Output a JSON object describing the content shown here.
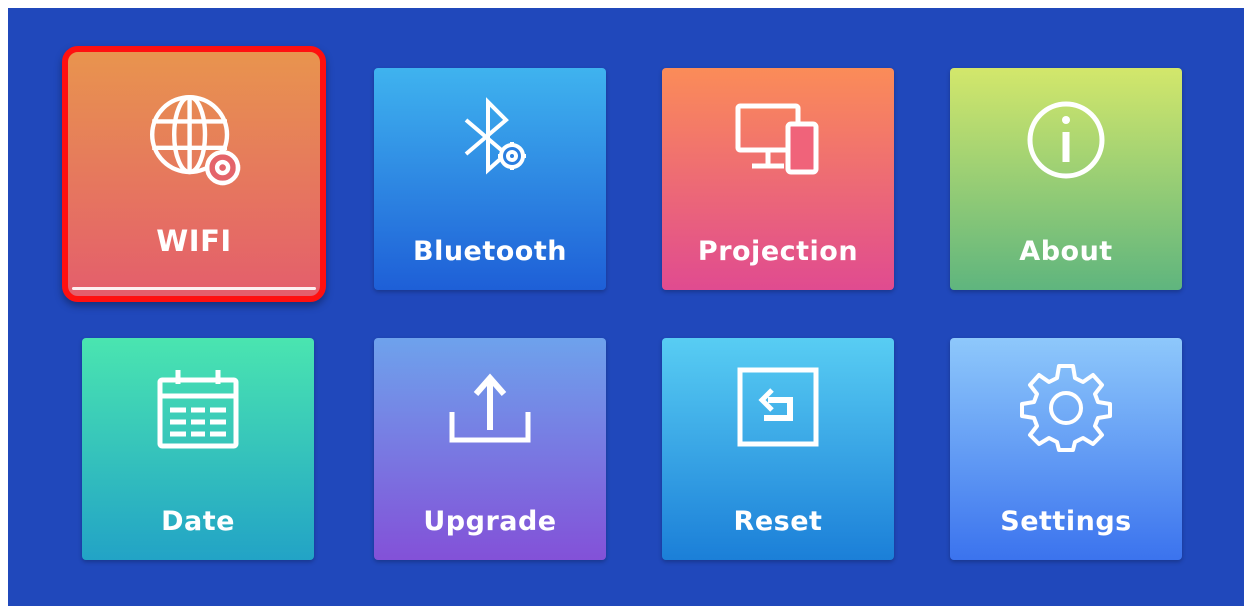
{
  "menu": {
    "tiles": [
      {
        "label": "WIFI",
        "icon": "globe-gear-icon",
        "selected": true
      },
      {
        "label": "Bluetooth",
        "icon": "bluetooth-gear-icon"
      },
      {
        "label": "Projection",
        "icon": "screen-devices-icon"
      },
      {
        "label": "About",
        "icon": "info-icon"
      },
      {
        "label": "Date",
        "icon": "calendar-icon"
      },
      {
        "label": "Upgrade",
        "icon": "upload-icon"
      },
      {
        "label": "Reset",
        "icon": "reset-icon"
      },
      {
        "label": "Settings",
        "icon": "gear-icon"
      }
    ]
  },
  "colors": {
    "background": "#2048bb",
    "focus_border": "#ff1010"
  }
}
